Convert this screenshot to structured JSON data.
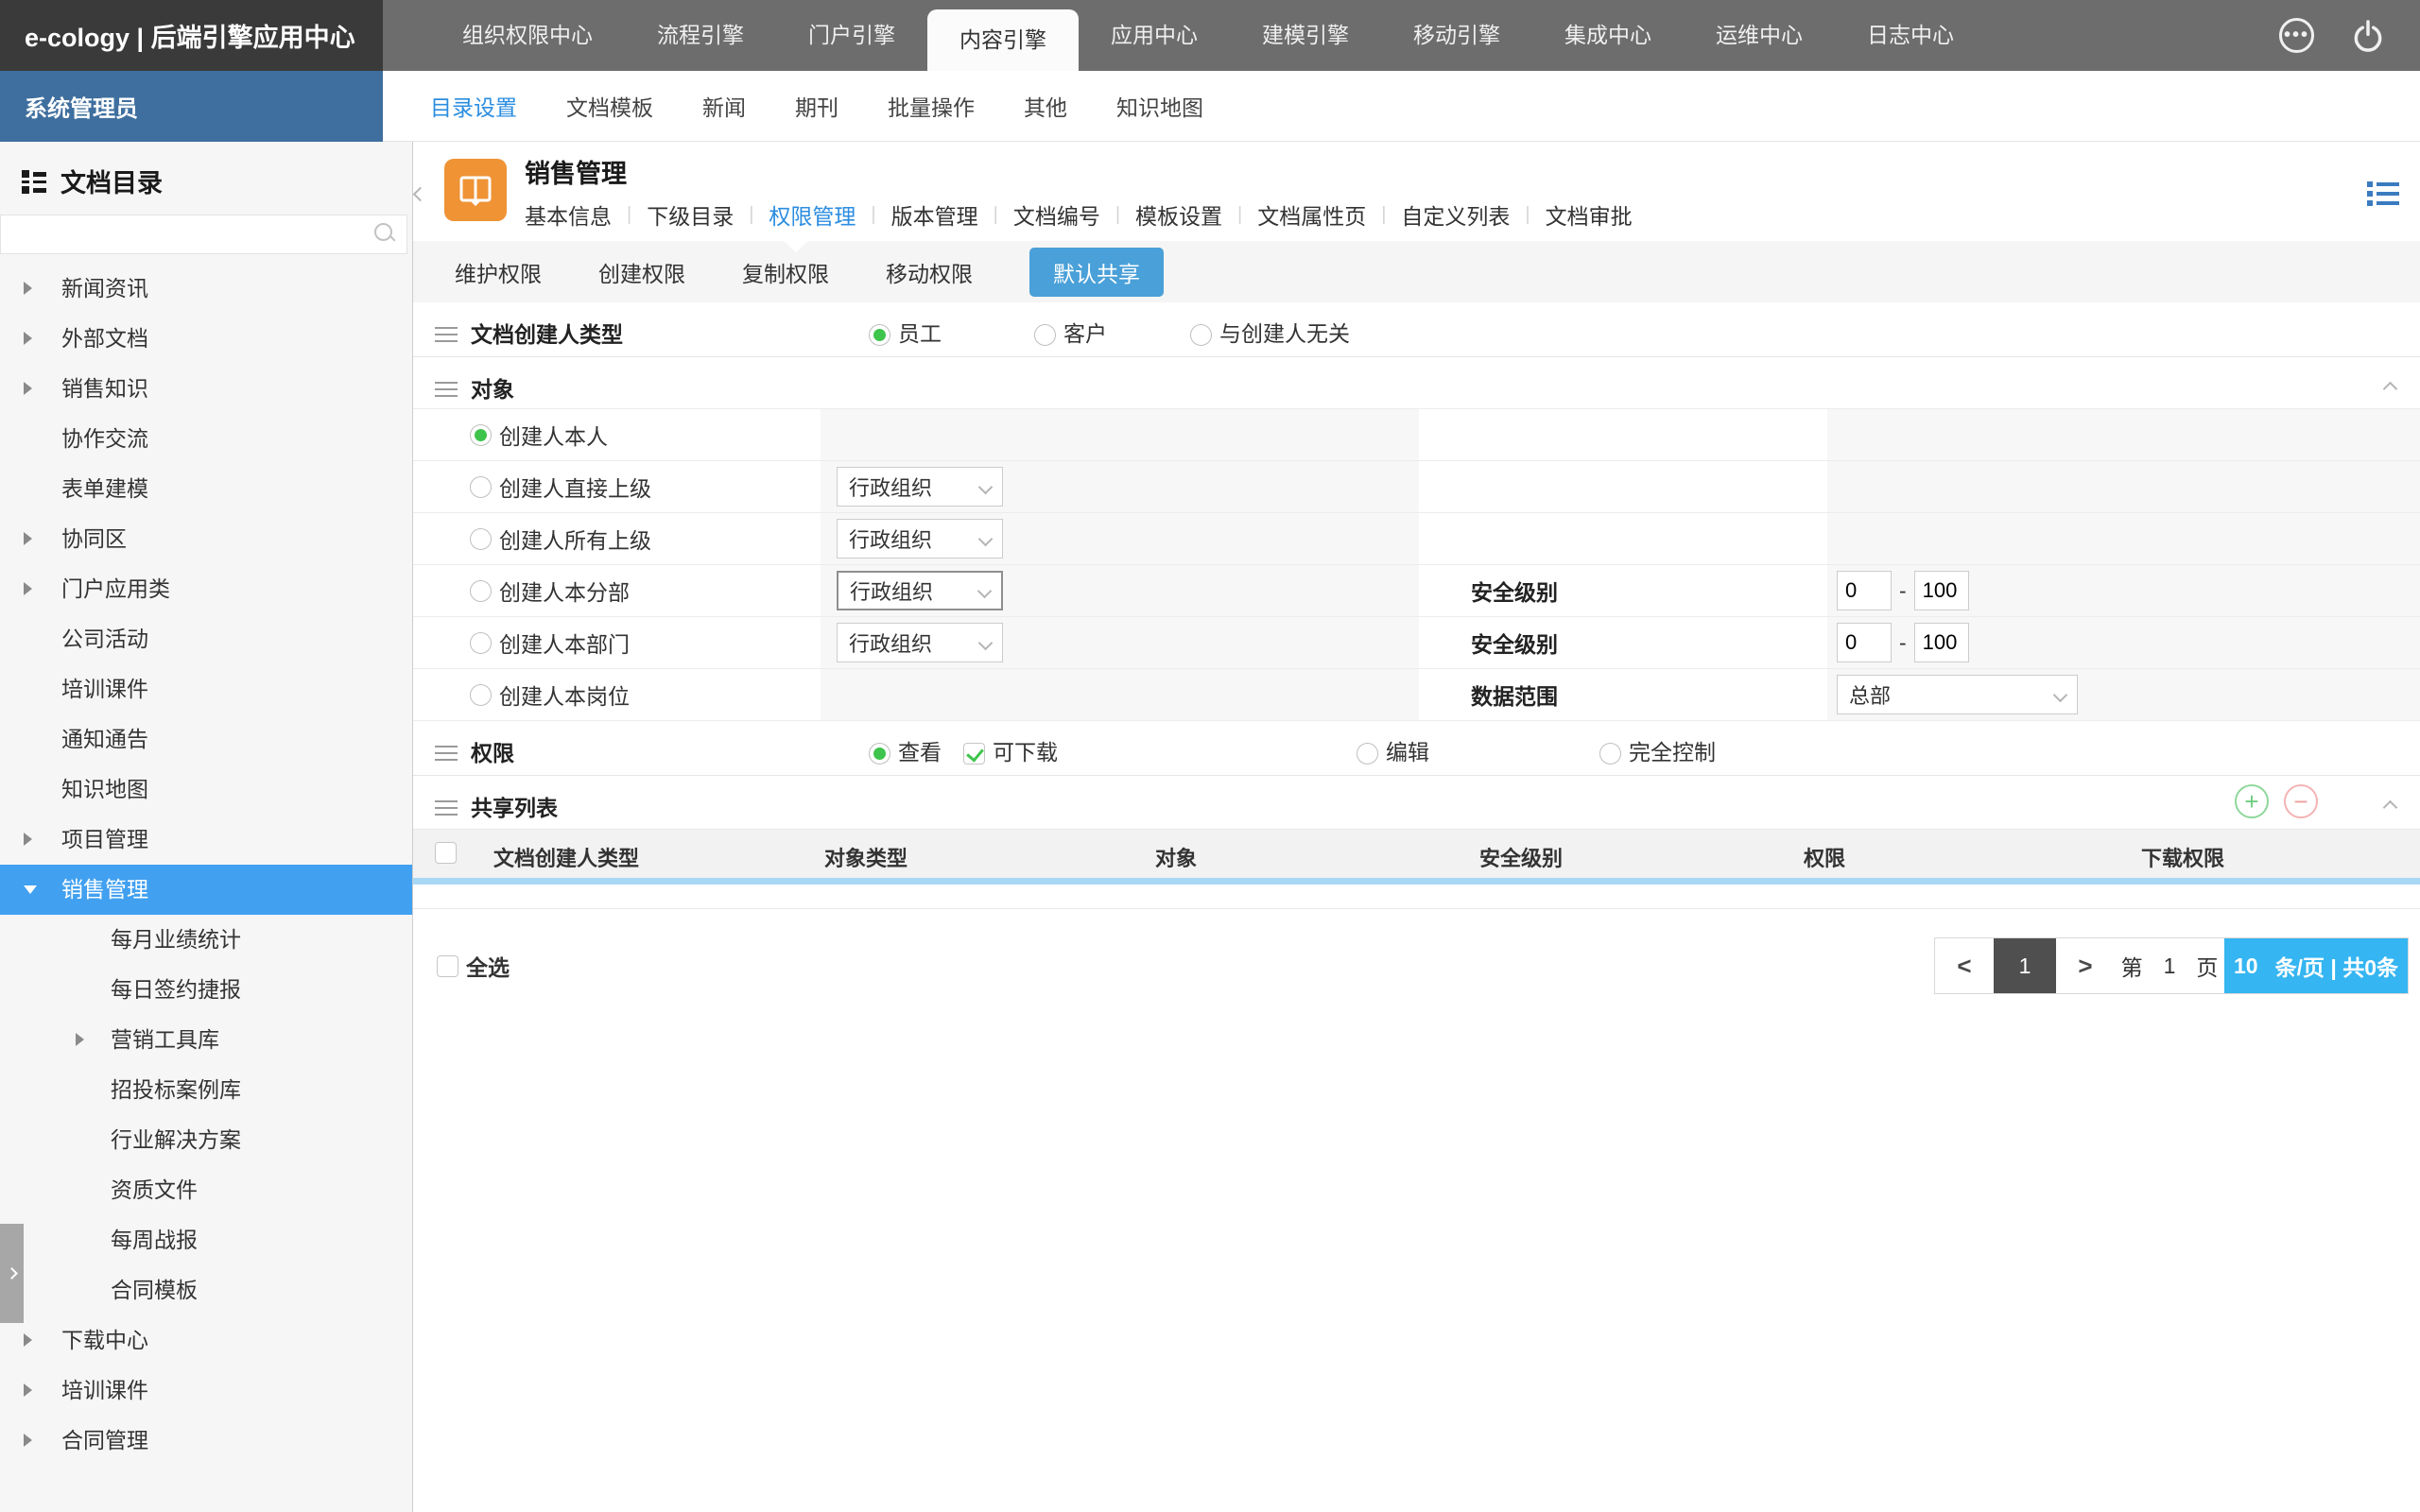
{
  "colors": {
    "topbar_dark": "#3a3a3a",
    "topbar_gray": "#6d6d6d",
    "admin_blue": "#3f6f9e",
    "link_blue": "#2b8de0",
    "selection_blue": "#41a0f0",
    "button_blue": "#4aa0d8",
    "pager_blue": "#35b5f1",
    "radio_green": "#3ec44c",
    "icon_orange": "#ef9335"
  },
  "topbar": {
    "logo": "e-cology | 后端引擎应用中心",
    "tabs": [
      {
        "label": "组织权限中心",
        "active": false
      },
      {
        "label": "流程引擎",
        "active": false
      },
      {
        "label": "门户引擎",
        "active": false
      },
      {
        "label": "内容引擎",
        "active": true
      },
      {
        "label": "应用中心",
        "active": false
      },
      {
        "label": "建模引擎",
        "active": false
      },
      {
        "label": "移动引擎",
        "active": false
      },
      {
        "label": "集成中心",
        "active": false
      },
      {
        "label": "运维中心",
        "active": false
      },
      {
        "label": "日志中心",
        "active": false
      }
    ]
  },
  "subbar": {
    "role": "系统管理员",
    "items": [
      {
        "label": "目录设置",
        "active": true
      },
      {
        "label": "文档模板",
        "active": false
      },
      {
        "label": "新闻",
        "active": false
      },
      {
        "label": "期刊",
        "active": false
      },
      {
        "label": "批量操作",
        "active": false
      },
      {
        "label": "其他",
        "active": false
      },
      {
        "label": "知识地图",
        "active": false
      }
    ]
  },
  "sidebar": {
    "title": "文档目录",
    "search_placeholder": "",
    "items": [
      {
        "label": "新闻资讯",
        "level": 0,
        "arrow": "collapsed",
        "active": false
      },
      {
        "label": "外部文档",
        "level": 0,
        "arrow": "collapsed",
        "active": false
      },
      {
        "label": "销售知识",
        "level": 0,
        "arrow": "collapsed",
        "active": false
      },
      {
        "label": "协作交流",
        "level": 0,
        "arrow": null,
        "active": false
      },
      {
        "label": "表单建模",
        "level": 0,
        "arrow": null,
        "active": false
      },
      {
        "label": "协同区",
        "level": 0,
        "arrow": "collapsed",
        "active": false
      },
      {
        "label": "门户应用类",
        "level": 0,
        "arrow": "collapsed",
        "active": false
      },
      {
        "label": "公司活动",
        "level": 0,
        "arrow": null,
        "active": false
      },
      {
        "label": "培训课件",
        "level": 0,
        "arrow": null,
        "active": false
      },
      {
        "label": "通知通告",
        "level": 0,
        "arrow": null,
        "active": false
      },
      {
        "label": "知识地图",
        "level": 0,
        "arrow": null,
        "active": false
      },
      {
        "label": "项目管理",
        "level": 0,
        "arrow": "collapsed",
        "active": false
      },
      {
        "label": "销售管理",
        "level": 0,
        "arrow": "expanded",
        "active": true
      },
      {
        "label": "每月业绩统计",
        "level": 1,
        "arrow": null,
        "active": false
      },
      {
        "label": "每日签约捷报",
        "level": 1,
        "arrow": null,
        "active": false
      },
      {
        "label": "营销工具库",
        "level": 1,
        "arrow": "collapsed",
        "active": false
      },
      {
        "label": "招投标案例库",
        "level": 1,
        "arrow": null,
        "active": false
      },
      {
        "label": "行业解决方案",
        "level": 1,
        "arrow": null,
        "active": false
      },
      {
        "label": "资质文件",
        "level": 1,
        "arrow": null,
        "active": false
      },
      {
        "label": "每周战报",
        "level": 1,
        "arrow": null,
        "active": false
      },
      {
        "label": "合同模板",
        "level": 1,
        "arrow": null,
        "active": false
      },
      {
        "label": "下载中心",
        "level": 0,
        "arrow": "collapsed",
        "active": false
      },
      {
        "label": "培训课件",
        "level": 0,
        "arrow": "collapsed",
        "active": false
      },
      {
        "label": "合同管理",
        "level": 0,
        "arrow": "collapsed",
        "active": false
      }
    ]
  },
  "content": {
    "title": "销售管理",
    "tabs": [
      {
        "label": "基本信息",
        "active": false
      },
      {
        "label": "下级目录",
        "active": false
      },
      {
        "label": "权限管理",
        "active": true
      },
      {
        "label": "版本管理",
        "active": false
      },
      {
        "label": "文档编号",
        "active": false
      },
      {
        "label": "模板设置",
        "active": false
      },
      {
        "label": "文档属性页",
        "active": false
      },
      {
        "label": "自定义列表",
        "active": false
      },
      {
        "label": "文档审批",
        "active": false
      }
    ],
    "subtabs": [
      {
        "label": "维护权限",
        "active": false
      },
      {
        "label": "创建权限",
        "active": false
      },
      {
        "label": "复制权限",
        "active": false
      },
      {
        "label": "移动权限",
        "active": false
      },
      {
        "label": "默认共享",
        "active": true
      }
    ],
    "creator_type": {
      "label": "文档创建人类型",
      "options": [
        {
          "label": "员工",
          "checked": true
        },
        {
          "label": "客户",
          "checked": false
        },
        {
          "label": "与创建人无关",
          "checked": false
        }
      ]
    },
    "object_section": {
      "title": "对象",
      "rows": [
        {
          "label": "创建人本人",
          "checked": true,
          "select": null,
          "right_label": null
        },
        {
          "label": "创建人直接上级",
          "checked": false,
          "select": "行政组织",
          "right_label": null
        },
        {
          "label": "创建人所有上级",
          "checked": false,
          "select": "行政组织",
          "right_label": null
        },
        {
          "label": "创建人本分部",
          "checked": false,
          "select": "行政组织",
          "focused": true,
          "right_label": "安全级别",
          "min": "0",
          "max": "100"
        },
        {
          "label": "创建人本部门",
          "checked": false,
          "select": "行政组织",
          "right_label": "安全级别",
          "min": "0",
          "max": "100"
        },
        {
          "label": "创建人本岗位",
          "checked": false,
          "select": null,
          "right_label": "数据范围",
          "right_select": "总部"
        }
      ]
    },
    "permission": {
      "label": "权限",
      "options": [
        {
          "label": "查看",
          "type": "radio",
          "checked": true
        },
        {
          "label": "可下载",
          "type": "checkbox",
          "checked": true
        },
        {
          "label": "编辑",
          "type": "radio",
          "checked": false
        },
        {
          "label": "完全控制",
          "type": "radio",
          "checked": false
        }
      ]
    },
    "share_list": {
      "title": "共享列表",
      "columns": [
        "文档创建人类型",
        "对象类型",
        "对象",
        "安全级别",
        "权限",
        "下载权限"
      ],
      "rows": []
    },
    "select_all": "全选",
    "pagination": {
      "prev": "<",
      "page": "1",
      "next": ">",
      "jump_prefix": "第",
      "jump_value": "1",
      "jump_suffix": "页",
      "page_size": "10",
      "total_info": "条/页 | 共0条"
    }
  }
}
